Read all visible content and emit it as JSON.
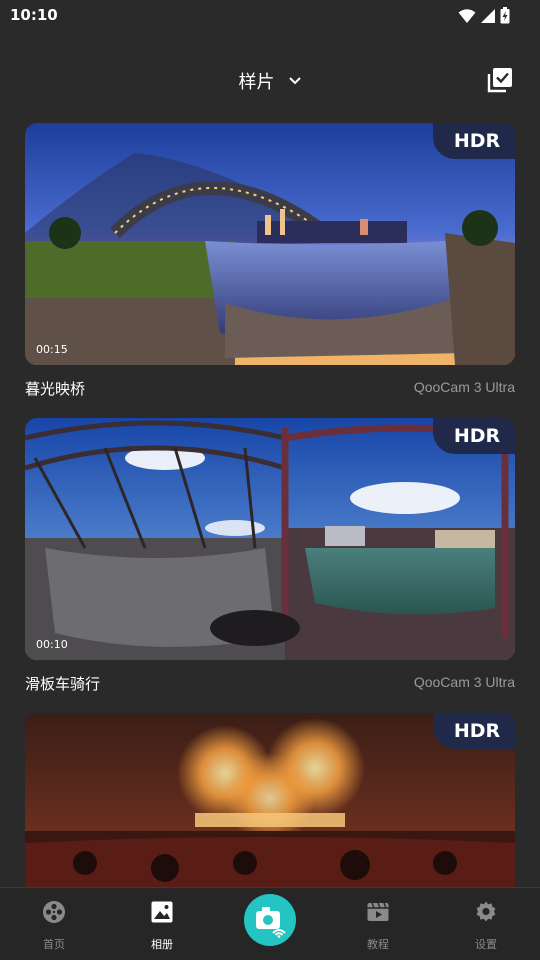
{
  "status_bar": {
    "time": "10:10"
  },
  "header": {
    "title": "样片"
  },
  "samples": [
    {
      "badge": "HDR",
      "duration": "00:15",
      "title": "暮光映桥",
      "device": "QooCam 3 Ultra"
    },
    {
      "badge": "HDR",
      "duration": "00:10",
      "title": "滑板车骑行",
      "device": "QooCam 3 Ultra"
    },
    {
      "badge": "HDR"
    }
  ],
  "bottom_nav": {
    "home": "首页",
    "album": "相册",
    "tutorial": "教程",
    "settings": "设置"
  },
  "colors": {
    "accent": "#23c4c1",
    "background": "#2a2a2a",
    "hdr_badge": "#20294a"
  }
}
